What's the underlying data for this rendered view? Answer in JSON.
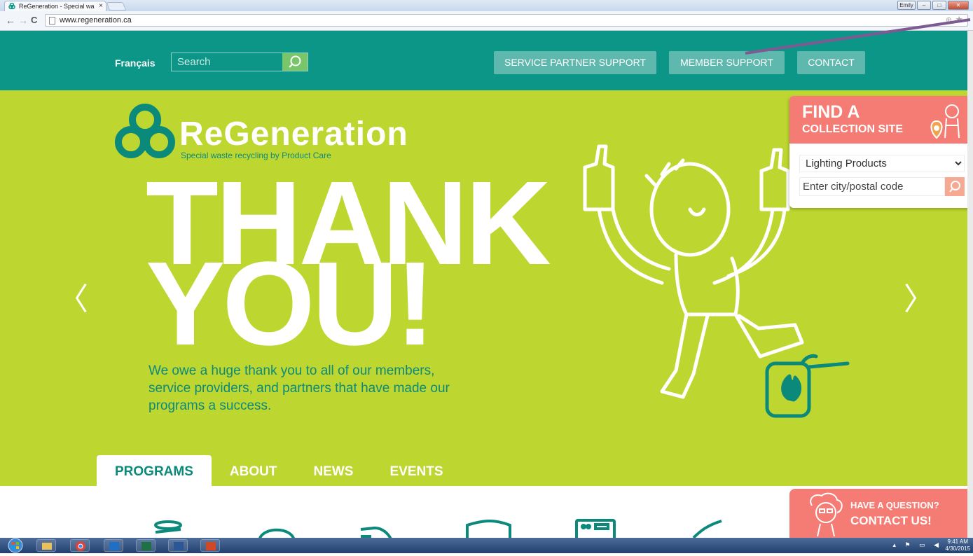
{
  "browser": {
    "tab_title": "ReGeneration - Special wa",
    "tab_close": "×",
    "url": "www.regeneration.ca",
    "back": "←",
    "forward": "→",
    "reload": "C",
    "user_badge": "Emily",
    "min": "–",
    "max": "□",
    "close": "✕"
  },
  "header": {
    "language": "Français",
    "search_placeholder": "Search",
    "buttons": [
      "SERVICE PARTNER SUPPORT",
      "MEMBER SUPPORT",
      "CONTACT"
    ]
  },
  "hero": {
    "logo_name": "ReGeneration",
    "logo_tagline": "Special waste recycling by Product Care",
    "headline_1": "THANK",
    "headline_2": "YOU!",
    "message": "We owe a huge thank you to all of our members, service providers, and partners that have made our programs a success.",
    "prev_arrow": "〈",
    "next_arrow": "〉"
  },
  "tabs": [
    "PROGRAMS",
    "ABOUT",
    "NEWS",
    "EVENTS"
  ],
  "finder": {
    "title_line1": "FIND A",
    "title_line2": "COLLECTION SITE",
    "category_selected": "Lighting Products",
    "city_placeholder": "Enter city/postal code"
  },
  "question": {
    "line1": "HAVE A QUESTION?",
    "line2": "CONTACT US!"
  },
  "taskbar": {
    "time": "9:41 AM",
    "date": "4/30/2015"
  },
  "colors": {
    "header_teal": "#0b9688",
    "hero_lime": "#bed730",
    "accent_coral": "#f47c74",
    "text_teal": "#0b8a7c"
  }
}
